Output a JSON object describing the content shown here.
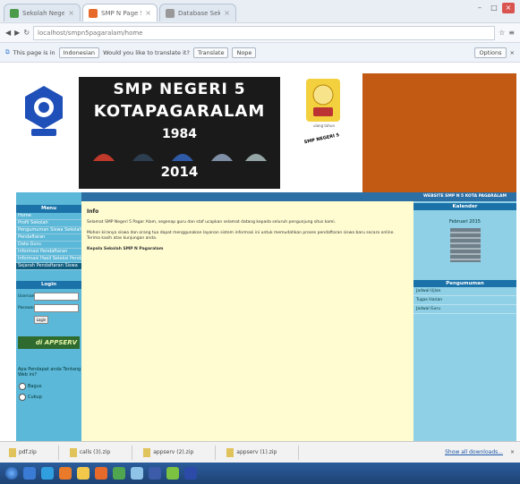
{
  "browser": {
    "tabs": [
      {
        "label": "Sekolah Negeri Pagaralam"
      },
      {
        "label": "SMP N Page Sms"
      },
      {
        "label": "Database Sekolah"
      }
    ],
    "address": "localhost/smpn5pagaralam/home",
    "translate_prefix": "This page is in",
    "translate_lang": "Indonesian",
    "translate_question": "Would you like to translate it?",
    "translate_btn": "Translate",
    "nope_btn": "Nope",
    "options_btn": "Options"
  },
  "banner": {
    "line1": "SMP NEGERI 5",
    "line2": "KOTAPAGARALAM",
    "year1": "1984",
    "year2": "2014",
    "badge_text": "ulang tahun"
  },
  "left_sidebar": {
    "header": "Menu",
    "items": [
      "Home",
      "Profil Sekolah",
      "Pengumuman Siswa Sekolah",
      "Pendaftaran",
      "Data Guru",
      "Informasi Pendaftaran",
      "Informasi Hasil Seleksi Pendaftaran",
      "Sejarah Pendaftaran Siswa"
    ],
    "login_header": "Login",
    "user_label": "Username",
    "pass_label": "Password",
    "login_btn": "Login",
    "logo_text": "di APPSERV",
    "poll_question": "Apa Pendapat anda Tentang Web ini?",
    "poll_opts": [
      "Bagus",
      "Cukup"
    ]
  },
  "content": {
    "title": "Info",
    "para1": "Selamat SMP Negeri 5 Pagar Alam, segenap guru dan staf ucapkan selamat datang kepada seluruh pengunjung situs kami.",
    "para2": "Mohon kiranya siswa dan orang tua dapat menggunakan layanan sistem informasi ini untuk memudahkan proses pendaftaran siswa baru secara online. Terima kasih atas kunjungan anda.",
    "para3": "Kepala Sekolah SMP N Pagaralam"
  },
  "right_sidebar": {
    "header": "WEBSITE SMP N 5 KOTA PAGARALAM",
    "calendar_header": "Kalender",
    "calendar_title": "Februari 2015",
    "links_header": "Pengumuman",
    "links": [
      "Jadwal Ujian",
      "Tugas Harian",
      "Jadwal Guru"
    ]
  },
  "downloads": [
    {
      "name": "pdf.zip"
    },
    {
      "name": "calls (3).zip"
    },
    {
      "name": "appserv (2).zip"
    },
    {
      "name": "appserv (1).zip"
    }
  ],
  "show_all_downloads": "Show all downloads..."
}
